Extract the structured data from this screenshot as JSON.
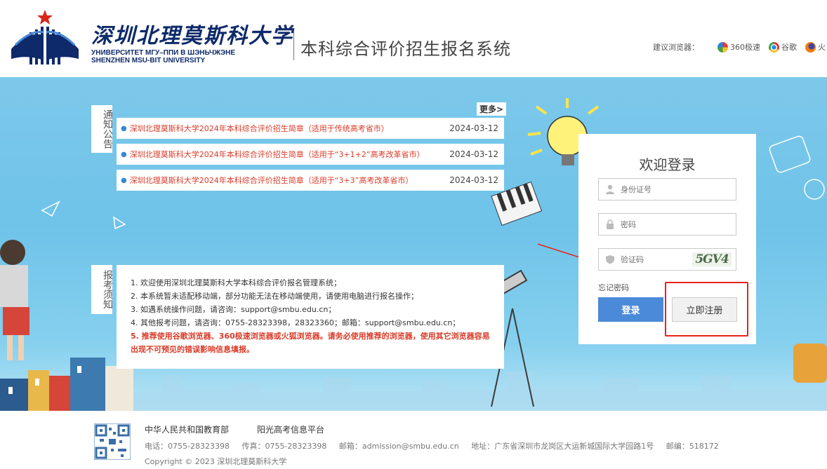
{
  "header": {
    "logo_cn": "深圳北理莫斯科大学",
    "logo_ru": "УНИВЕРСИТЕТ МГУ–ППИ В ШЭНЬЧЖЭНЕ",
    "logo_en": "SHENZHEN MSU-BIT UNIVERSITY",
    "system_title": "本科综合评价招生报名系统",
    "browser_label": "建议浏览器：",
    "browsers": [
      {
        "name": "360极速",
        "icon": "360-browser-icon"
      },
      {
        "name": "谷歌",
        "icon": "chrome-icon"
      },
      {
        "name": "火",
        "icon": "firefox-icon"
      }
    ]
  },
  "notice": {
    "label": "通知公告",
    "more": "更多>",
    "items": [
      {
        "title": "深圳北理莫斯科大学2024年本科综合评价招生简章（适用于传统高考省市）",
        "date": "2024-03-12"
      },
      {
        "title": "深圳北理莫斯科大学2024年本科综合评价招生简章（适用于“3+1+2”高考改革省市）",
        "date": "2024-03-12"
      },
      {
        "title": "深圳北理莫斯科大学2024年本科综合评价招生简章（适用于“3+3”高考改革省市）",
        "date": "2024-03-12"
      }
    ]
  },
  "guide": {
    "label": "报考须知",
    "lines": [
      "1. 欢迎使用深圳北理莫斯科大学本科综合评价报名管理系统；",
      "2. 本系统暂未适配移动端，部分功能无法在移动端使用，请使用电脑进行报名操作；",
      "3. 如遇系统操作问题，请咨询：support@smbu.edu.cn；",
      "4. 其他报考问题，请咨询：0755-28323398，28323360；邮箱：support@smbu.edu.cn；"
    ],
    "warning": "5. 推荐使用谷歌浏览器、360极速浏览器或火狐浏览器。请务必使用推荐的浏览器，使用其它浏览器容易出现不可预见的错误影响信息填报。"
  },
  "login": {
    "title": "欢迎登录",
    "id_placeholder": "身份证号",
    "password_placeholder": "密码",
    "captcha_placeholder": "验证码",
    "captcha_text": "5GV4",
    "forgot": "忘记密码",
    "login_button": "登录",
    "register_button": "立即注册"
  },
  "footer": {
    "links": [
      "中华人民共和国教育部",
      "阳光高考信息平台"
    ],
    "phone": "电话：0755-28323398",
    "fax": "传真：0755-28323398",
    "email": "邮箱：admission@smbu.edu.cn",
    "address": "地址：广东省深圳市龙岗区大运新城国际大学园路1号",
    "postcode": "邮编：518172",
    "copyright": "Copyright © 2023 深圳北理莫斯科大学"
  },
  "colors": {
    "accent": "#4a8ad8",
    "notice_red": "#d93b28",
    "highlight_red": "#e5241c",
    "brand_blue": "#0e2a6b"
  }
}
